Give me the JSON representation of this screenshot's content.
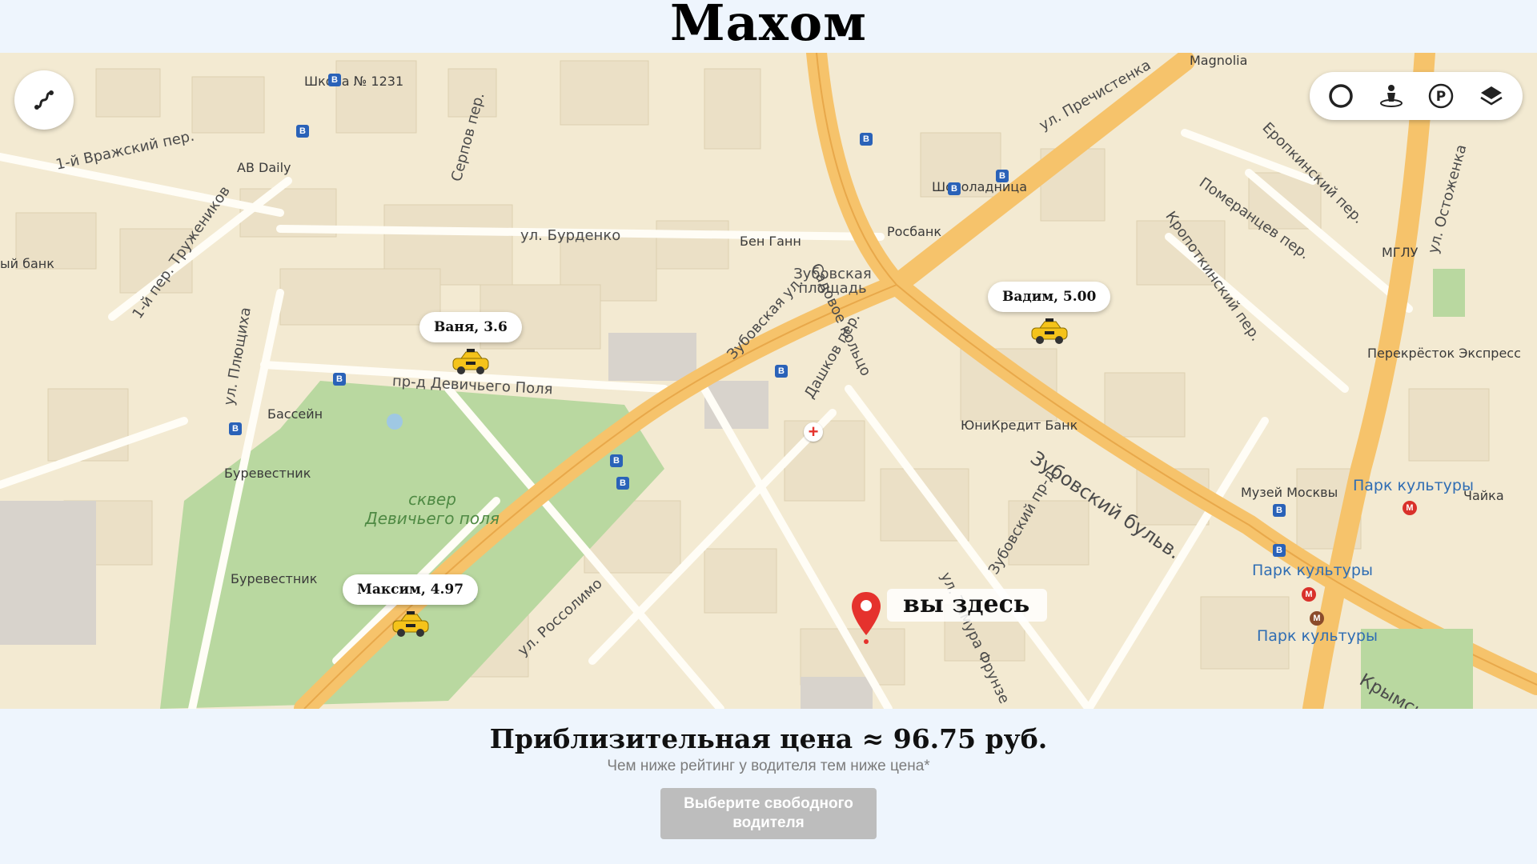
{
  "app": {
    "title": "Махом"
  },
  "map": {
    "you_here_label": "вы здесь",
    "drivers": [
      {
        "label": "Ваня, 3.6"
      },
      {
        "label": "Вадим, 5.00"
      },
      {
        "label": "Максим, 4.97"
      }
    ],
    "street_labels": {
      "sadovoe": "Садовое кольцо",
      "zubovsky_bulv": "Зубовский бульв.",
      "devichego_polya": "пр-д Девичьего Поля",
      "burdenko": "ул. Бурденко",
      "zubovskaya": "Зубовская ул.",
      "prechistenka": "ул. Пречистенка",
      "vrazhsky": "1-й Вражский пер.",
      "truzhenikov": "1-й пер. Тружеников",
      "plyushchikha": "ул. Плющиха",
      "serpov": "Серпов пер.",
      "dashkov": "Дашков пер.",
      "rossolimo": "ул. Россолимо",
      "zubovsky_pr": "Зубовский пр-д",
      "frunze": "ул. Тимура Фрунзе",
      "pomerantsev": "Померанцев пер.",
      "kropotkinsky": "Кропоткинский пер.",
      "eropkinsky": "Еропкинский пер.",
      "ostozhenka": "ул. Остоженка",
      "krymsky": "Крымский пр-д",
      "zubovskaya_ploshchad": "Зубовская площадь"
    },
    "park_label": "сквер Девичьего поля",
    "poi_labels": {
      "school": "Школа № 1231",
      "ab_daily": "AB Daily",
      "basseyn": "Бассейн",
      "burevestnik1": "Буревестник",
      "burevestnik2": "Буревестник",
      "rosbank": "Росбанк",
      "shokoladnitsa": "Шоколадница",
      "unicredit": "ЮниКредит Банк",
      "ben_gann": "Бен Ганн",
      "magnolia": "Magnolia",
      "mglu": "МГЛУ",
      "perekrestok": "Перекрёсток Экспресс",
      "muzey": "Музей Москвы",
      "park_kultury": "Парк культуры",
      "park_kultury2": "Парк культуры",
      "park_kultury3": "Парк культуры",
      "chayka": "Чайка",
      "bank_left": "ый банк"
    }
  },
  "footer": {
    "price_text": "Приблизительная цена ≈ 96.75 руб.",
    "rating_note": "Чем ниже рейтинг у водителя тем ниже цена*",
    "choose_button": "Выберите свободного водителя"
  },
  "colors": {
    "page_bg": "#eef5fd",
    "map_bg": "#f3ead2",
    "main_road": "#f6c36b",
    "park": "#b9d8a0",
    "button_disabled": "#bdbdbd",
    "pin": "#e5322d"
  }
}
